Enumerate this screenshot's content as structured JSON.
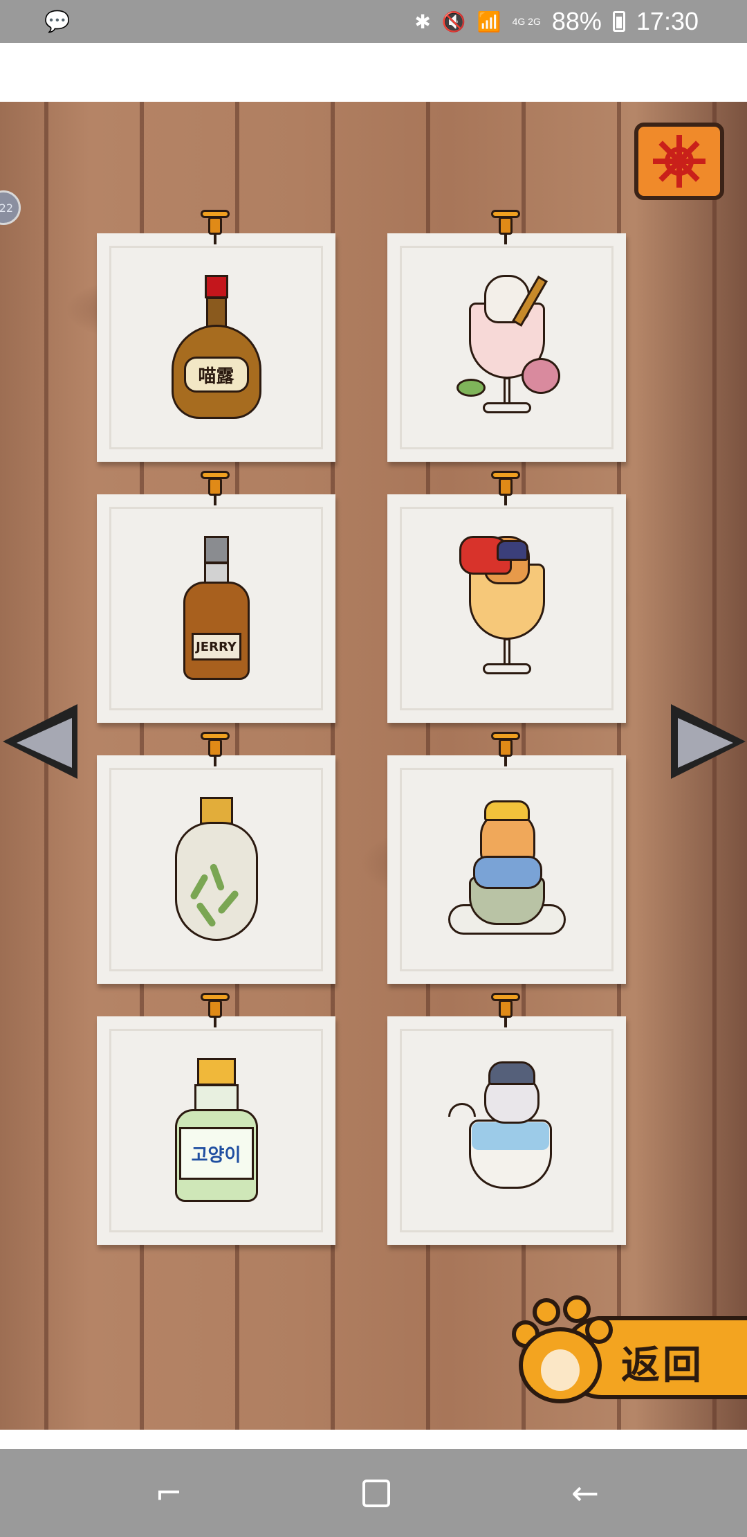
{
  "status_bar": {
    "left_icon": "wechat-icon",
    "network": "4G 2G",
    "battery": "88%",
    "time": "17:30",
    "icons": [
      "bluetooth-icon",
      "mute-icon",
      "wifi-icon",
      "signal-icon",
      "battery-icon"
    ]
  },
  "side_badge": {
    "text": "22"
  },
  "settings": {
    "icon": "gear-icon",
    "color": "#f08a2a"
  },
  "cards": [
    {
      "item": "amber-liquor-bottle",
      "label": "喵露"
    },
    {
      "item": "cat-cocktail-rose"
    },
    {
      "item": "whisky-bottle",
      "label": "JERRY"
    },
    {
      "item": "cat-orange-cocktail"
    },
    {
      "item": "bamboo-vase-bottle"
    },
    {
      "item": "cat-teacup"
    },
    {
      "item": "green-soju-bottle",
      "label": "고양이"
    },
    {
      "item": "cat-bowl"
    }
  ],
  "navigation": {
    "prev": "left-arrow-icon",
    "next": "right-arrow-icon"
  },
  "back_button": {
    "label": "返回"
  },
  "system_nav": {
    "recent": "recent-apps-icon",
    "home": "home-icon",
    "back": "back-icon"
  },
  "colors": {
    "wood": "#b07f61",
    "card": "#f1efeb",
    "paw": "#f3a420",
    "status_bar": "#9a9a9a"
  }
}
